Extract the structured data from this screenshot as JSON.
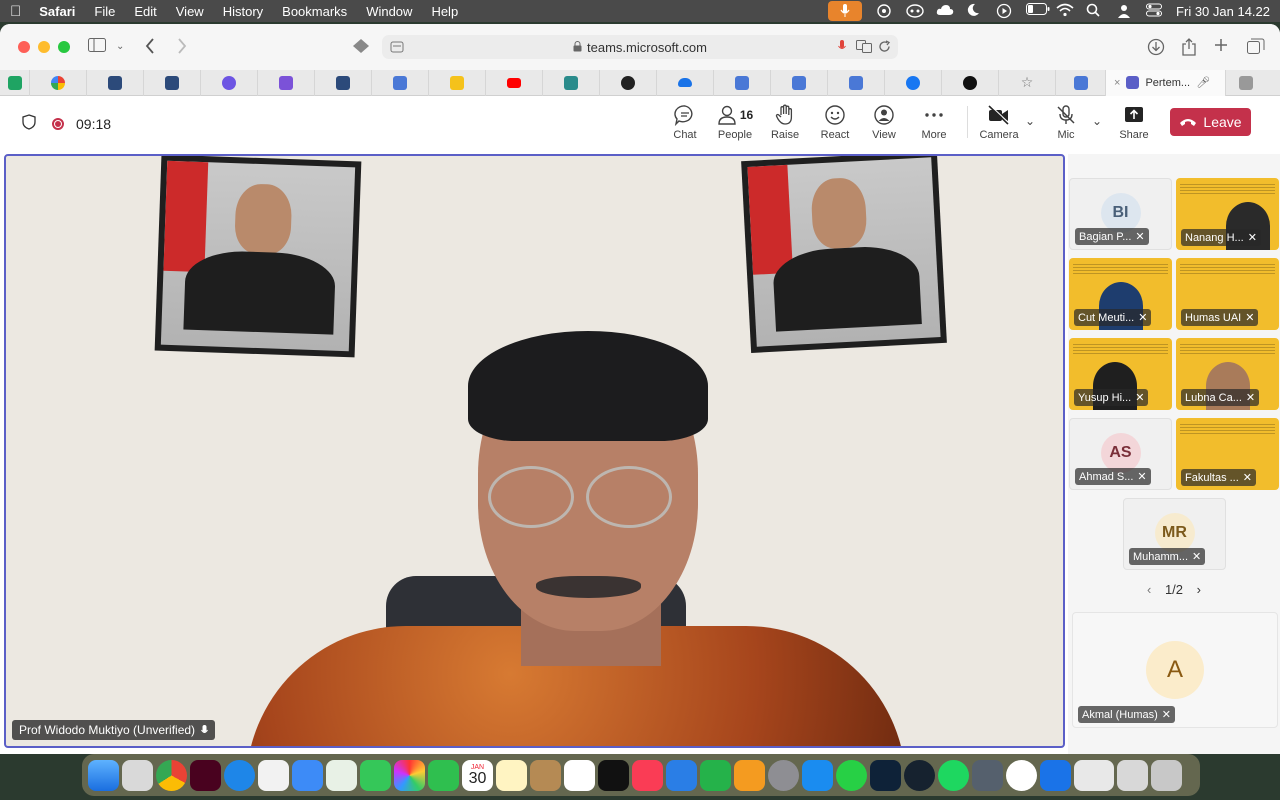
{
  "menubar": {
    "app": "Safari",
    "items": [
      "File",
      "Edit",
      "View",
      "History",
      "Bookmarks",
      "Window",
      "Help"
    ],
    "clock": "Fri 30 Jan  14.22"
  },
  "browser": {
    "url": "teams.microsoft.com",
    "active_tab": "Pertem..."
  },
  "meeting": {
    "timer": "09:18",
    "people_count": "16",
    "controls": {
      "chat": "Chat",
      "people": "People",
      "raise": "Raise",
      "react": "React",
      "view": "View",
      "more": "More",
      "camera": "Camera",
      "mic": "Mic",
      "share": "Share",
      "leave": "Leave"
    },
    "speaker": "Prof Widodo Muktiyo (Unverified)"
  },
  "gallery": {
    "tiles": [
      {
        "label": "Bagian P...",
        "initials": "BI"
      },
      {
        "label": "Nanang H..."
      },
      {
        "label": "Cut Meuti..."
      },
      {
        "label": "Humas UAI"
      },
      {
        "label": "Yusup Hi..."
      },
      {
        "label": "Lubna Ca..."
      },
      {
        "label": "Ahmad S...",
        "initials": "AS"
      },
      {
        "label": "Fakultas ..."
      },
      {
        "label": "Muhamm...",
        "initials": "MR"
      }
    ],
    "pager": "1/2",
    "featured": {
      "label": "Akmal (Humas)",
      "initial": "A"
    }
  },
  "dock": {
    "calendar_month": "JAN",
    "calendar_day": "30"
  },
  "colors": {
    "accent": "#5b5fc7",
    "leave": "#c4314b",
    "slide_yellow": "#f2bd2c"
  }
}
